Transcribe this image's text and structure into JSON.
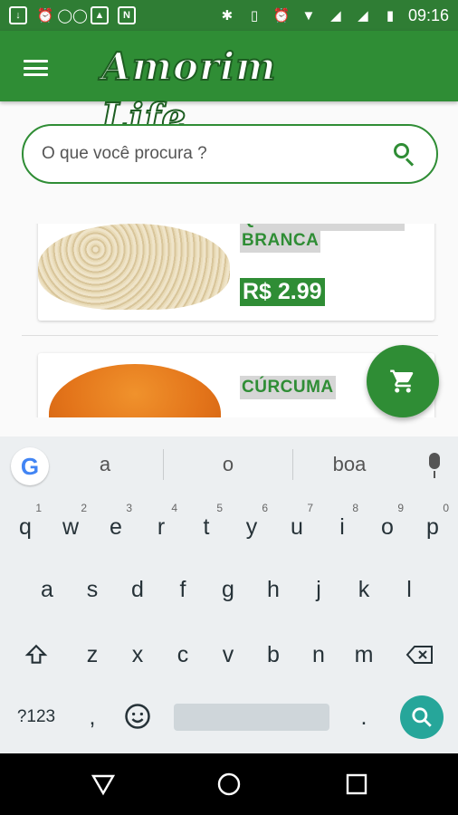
{
  "status_bar": {
    "time": "09:16"
  },
  "app_bar": {
    "title": "Amorim Life"
  },
  "search": {
    "placeholder": "O que você procura ?"
  },
  "products": [
    {
      "name_line1": "QUINOA EM GRÃO",
      "name_line2": "BRANCA",
      "price": "R$ 2.99"
    },
    {
      "name": "CÚRCUMA"
    }
  ],
  "keyboard": {
    "suggestions": [
      "a",
      "o",
      "boa"
    ],
    "row1": [
      {
        "key": "q",
        "hint": "1"
      },
      {
        "key": "w",
        "hint": "2"
      },
      {
        "key": "e",
        "hint": "3"
      },
      {
        "key": "r",
        "hint": "4"
      },
      {
        "key": "t",
        "hint": "5"
      },
      {
        "key": "y",
        "hint": "6"
      },
      {
        "key": "u",
        "hint": "7"
      },
      {
        "key": "i",
        "hint": "8"
      },
      {
        "key": "o",
        "hint": "9"
      },
      {
        "key": "p",
        "hint": "0"
      }
    ],
    "row2": [
      "a",
      "s",
      "d",
      "f",
      "g",
      "h",
      "j",
      "k",
      "l"
    ],
    "row3": [
      "z",
      "x",
      "c",
      "v",
      "b",
      "n",
      "m"
    ],
    "symbols_key": "?123",
    "comma_key": ",",
    "period_key": "."
  },
  "colors": {
    "primary": "#2f8d35",
    "status_bar": "#2f7d34",
    "price_bg": "#2f8d35",
    "action_key": "#26a69a"
  }
}
